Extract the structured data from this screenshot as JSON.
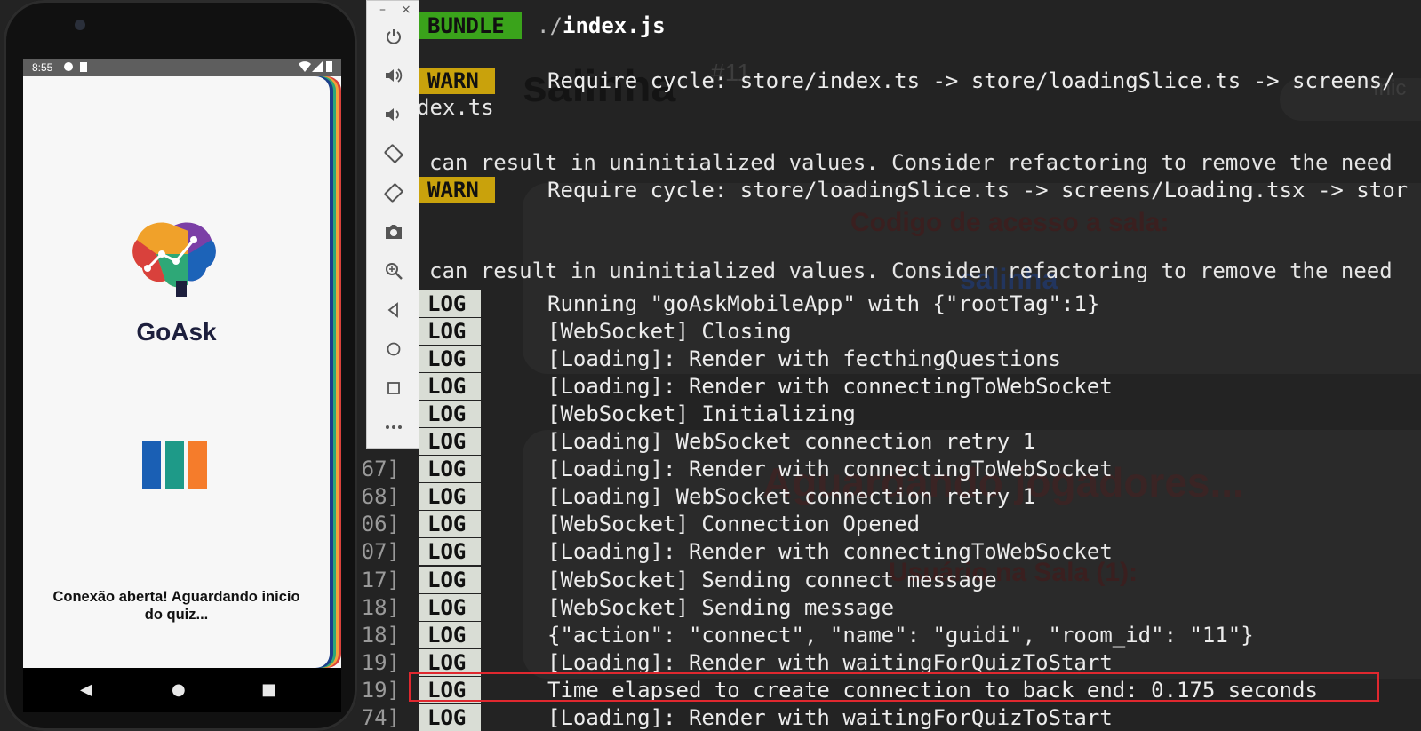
{
  "phone": {
    "status_time": "8:55",
    "app_name": "GoAsk",
    "status_message": "Conexão aberta! Aguardando inicio do quiz...",
    "bar_colors": [
      "#1a5fb4",
      "#1e9a88",
      "#f57c2b"
    ]
  },
  "toolbar": {
    "minimize": "–",
    "close": "×",
    "buttons": [
      "power-icon",
      "volume-up-icon",
      "volume-down-icon",
      "rotate-left-icon",
      "rotate-right-icon",
      "camera-icon",
      "zoom-icon",
      "back-icon",
      "home-icon",
      "overview-icon",
      "more-icon"
    ]
  },
  "background_app": {
    "room_title": "salinha",
    "room_number": "#11",
    "access_code_label": "Codigo de acesso a sala:",
    "access_code": "salinha",
    "waiting_title": "Aguardando jogadores...",
    "users_label": "Usuário na Sala (1):",
    "user": "guidi",
    "top_right": "Inic"
  },
  "terminal": {
    "bundle_tag": "BUNDLE",
    "bundle_path_prefix": "./",
    "bundle_path": "index.js",
    "warn_tag": "WARN",
    "log_tag": "LOG",
    "warn1": "Require cycle: store/index.ts -> store/loadingSlice.ts -> screens/",
    "warn1_cont": "dex.ts",
    "warn_text": "can result in uninitialized values. Consider refactoring to remove the need",
    "warn2": "Require cycle: store/loadingSlice.ts -> screens/Loading.tsx -> stor",
    "warn2_text": "can result in uninitialized values. Consider refactoring to remove the need",
    "gutter": [
      "67]",
      "68]",
      "06]",
      "07]",
      "17]",
      "18]",
      "18]",
      "19]",
      "19]",
      "74]"
    ],
    "logs": [
      "Running \"goAskMobileApp\" with {\"rootTag\":1}",
      "[WebSocket] Closing",
      "[Loading]: Render with fecthingQuestions",
      "[Loading]: Render with connectingToWebSocket",
      "[WebSocket] Initializing",
      "[Loading] WebSocket connection retry 1",
      "[Loading]: Render with connectingToWebSocket",
      "[Loading] WebSocket connection retry 1",
      "[WebSocket] Connection Opened",
      "[Loading]: Render with connectingToWebSocket",
      "[WebSocket] Sending connect message",
      "[WebSocket] Sending message",
      "{\"action\": \"connect\", \"name\": \"guidi\", \"room_id\": \"11\"}",
      "[Loading]: Render with waitingForQuizToStart",
      "Time elapsed to create connection to back end:  0.175  seconds",
      "[Loading]: Render with waitingForQuizToStart"
    ],
    "highlight_color": "#e0282f"
  }
}
